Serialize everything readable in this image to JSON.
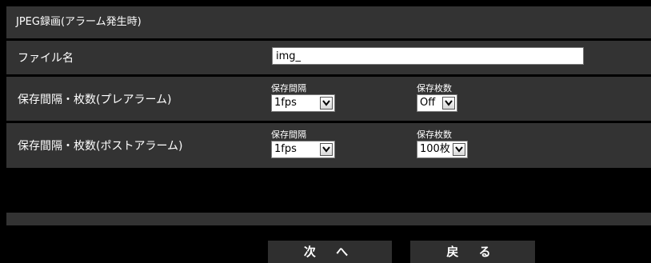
{
  "section": {
    "title": "JPEG録画(アラーム発生時)"
  },
  "filename": {
    "label": "ファイル名",
    "value": "img_"
  },
  "pre_alarm": {
    "label": "保存間隔・枚数(プレアラーム)",
    "interval_label": "保存間隔",
    "interval_value": "1fps",
    "count_label": "保存枚数",
    "count_value": "Off"
  },
  "post_alarm": {
    "label": "保存間隔・枚数(ポストアラーム)",
    "interval_label": "保存間隔",
    "interval_value": "1fps",
    "count_label": "保存枚数",
    "count_value": "100枚"
  },
  "buttons": {
    "next": "次 へ",
    "back": "戻 る"
  },
  "icons": {
    "dropdown": "chevron-down-icon"
  }
}
